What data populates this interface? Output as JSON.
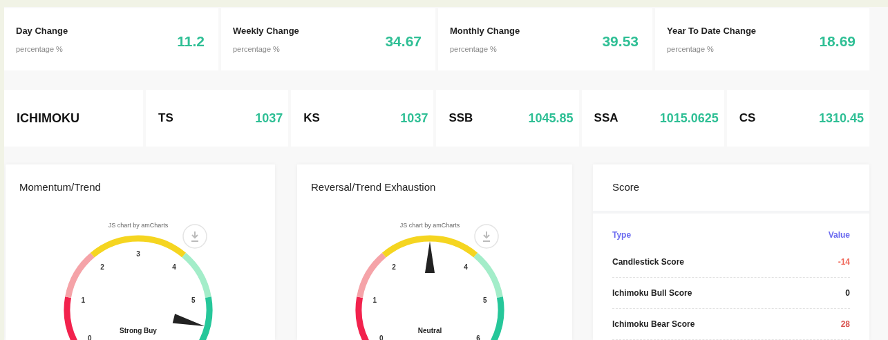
{
  "changes": [
    {
      "title": "Day Change",
      "subtitle": "percentage %",
      "value": "11.2"
    },
    {
      "title": "Weekly Change",
      "subtitle": "percentage %",
      "value": "34.67"
    },
    {
      "title": "Monthly Change",
      "subtitle": "percentage %",
      "value": "39.53"
    },
    {
      "title": "Year To Date Change",
      "subtitle": "percentage %",
      "value": "18.69"
    }
  ],
  "ichimoku": {
    "title": "ICHIMOKU",
    "items": [
      {
        "label": "TS",
        "value": "1037"
      },
      {
        "label": "KS",
        "value": "1037"
      },
      {
        "label": "SSB",
        "value": "1045.85"
      },
      {
        "label": "SSA",
        "value": "1015.0625"
      },
      {
        "label": "CS",
        "value": "1310.45"
      }
    ]
  },
  "gauges": [
    {
      "title": "Momentum/Trend",
      "credit": "JS chart by amCharts",
      "ticks": [
        "0",
        "1",
        "2",
        "3",
        "4",
        "5"
      ],
      "reading": "Strong Buy"
    },
    {
      "title": "Reversal/Trend Exhaustion",
      "credit": "JS chart by amCharts",
      "ticks": [
        "0",
        "1",
        "2",
        "4",
        "5",
        "6"
      ],
      "reading": "Neutral"
    }
  ],
  "score": {
    "title": "Score",
    "columns": [
      "Type",
      "Value"
    ],
    "rows": [
      {
        "type": "Candlestick Score",
        "value": "-14",
        "color": "#f0685a"
      },
      {
        "type": "Ichimoku Bull Score",
        "value": "0",
        "color": "#222222"
      },
      {
        "type": "Ichimoku Bear Score",
        "value": "28",
        "color": "#d9534f"
      }
    ]
  }
}
